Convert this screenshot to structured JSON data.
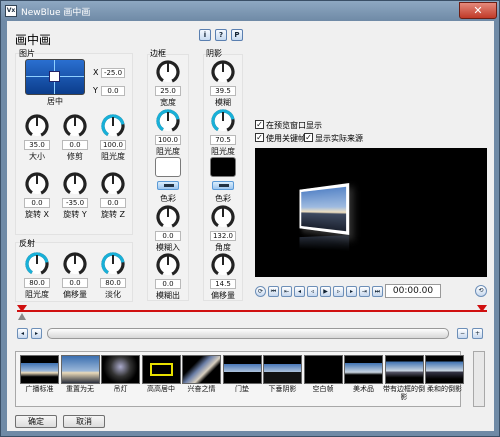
{
  "window": {
    "title": "NewBlue 画中画",
    "icon_text": "Vx",
    "close": "✕"
  },
  "header": {
    "title": "画中画",
    "tool_info": "i",
    "tool_help": "?",
    "tool_p": "P"
  },
  "picture": {
    "group": "图片",
    "position_label": "居中",
    "x_label": "X",
    "x_value": "-25.0",
    "y_label": "Y",
    "y_value": "0.0",
    "knobs": [
      {
        "value": "35.0",
        "label": "大小"
      },
      {
        "value": "0.0",
        "label": "修剪"
      },
      {
        "value": "100.0",
        "label": "阻光度"
      },
      {
        "value": "0.0",
        "label": "旋转 X"
      },
      {
        "value": "-35.0",
        "label": "旋转 Y"
      },
      {
        "value": "0.0",
        "label": "旋转 Z"
      }
    ]
  },
  "reflection": {
    "group": "反射",
    "knobs": [
      {
        "value": "80.0",
        "label": "阻光度"
      },
      {
        "value": "0.0",
        "label": "偏移量"
      },
      {
        "value": "80.0",
        "label": "淡化"
      }
    ]
  },
  "border": {
    "group": "边框",
    "knobs": [
      {
        "value": "25.0",
        "label": "宽度"
      },
      {
        "value": "100.0",
        "label": "阻光度"
      }
    ],
    "color_label": "色彩",
    "knobs2": [
      {
        "value": "0.0",
        "label": "模糊入"
      },
      {
        "value": "0.0",
        "label": "模糊出"
      }
    ]
  },
  "shadow": {
    "group": "阴影",
    "knobs": [
      {
        "value": "39.5",
        "label": "模糊"
      },
      {
        "value": "70.5",
        "label": "阻光度"
      }
    ],
    "color_label": "色彩",
    "knobs2": [
      {
        "value": "132.0",
        "label": "角度"
      },
      {
        "value": "14.5",
        "label": "偏移量"
      }
    ]
  },
  "options": {
    "show_in_preview": "在预览窗口显示",
    "use_keyframes": "使用关键帧",
    "show_actual_source": "显示实际来源"
  },
  "playback": {
    "timecode": "00:00.00"
  },
  "presets": [
    {
      "label": "广播标准"
    },
    {
      "label": "重置为无"
    },
    {
      "label": "吊灯"
    },
    {
      "label": "高高居中"
    },
    {
      "label": "兴奋之情"
    },
    {
      "label": "门垫"
    },
    {
      "label": "下垂阴影"
    },
    {
      "label": "空白帧"
    },
    {
      "label": "美术品"
    },
    {
      "label": "带有边框的倒影"
    },
    {
      "label": "柔和的倒影"
    }
  ],
  "footer": {
    "ok": "确定",
    "cancel": "取消"
  },
  "colors": {
    "accent": "#1e90ff",
    "knob_ring": "#18b0d8",
    "track_red": "#d01010"
  }
}
